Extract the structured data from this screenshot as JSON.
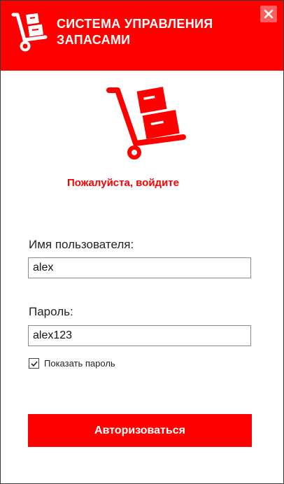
{
  "header": {
    "title": "СИСТЕМА УПРАВЛЕНИЯ ЗАПАСАМИ",
    "logo_icon": "hand-truck-boxes-icon",
    "close_icon": "close-icon"
  },
  "main_logo_icon": "hand-truck-boxes-icon",
  "prompt": "Пожалуйста, войдите",
  "username": {
    "label": "Имя пользователя:",
    "value": "alex"
  },
  "password": {
    "label": "Пароль:",
    "value": "alex123"
  },
  "show_password": {
    "label": "Показать пароль",
    "checked": true
  },
  "login_button": "Авторизоваться",
  "colors": {
    "accent": "#ff0000",
    "close_bg": "#ff5c5c",
    "header_text": "#ffffff"
  }
}
